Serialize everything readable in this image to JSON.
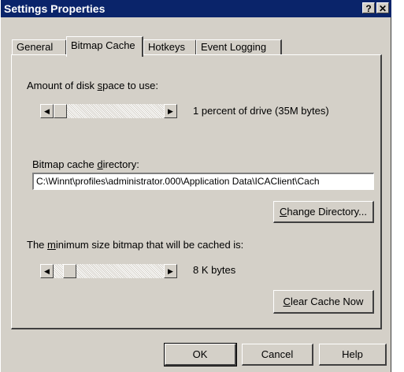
{
  "window": {
    "title": "Settings Properties",
    "help_button": "?",
    "close_button": "✕"
  },
  "tabs": [
    {
      "label": "General",
      "active": false
    },
    {
      "label": "Bitmap Cache",
      "active": true
    },
    {
      "label": "Hotkeys",
      "active": false
    },
    {
      "label": "Event Logging",
      "active": false
    }
  ],
  "disk_space": {
    "label_before": "Amount of disk ",
    "label_accel": "s",
    "label_after": "pace to use:",
    "value_text": "1 percent of drive (35M bytes)",
    "left_arrow": "◀",
    "right_arrow": "▶"
  },
  "cache_dir": {
    "label_before": "Bitmap cache ",
    "label_accel": "d",
    "label_after": "irectory:",
    "value": "C:\\Winnt\\profiles\\administrator.000\\Application Data\\ICAClient\\Cach",
    "change_button_accel": "C",
    "change_button_rest": "hange Directory..."
  },
  "min_size": {
    "label_before": "The ",
    "label_accel": "m",
    "label_after": "inimum size bitmap that will be cached is:",
    "value_text": "8  K bytes",
    "left_arrow": "◀",
    "right_arrow": "▶",
    "clear_button_accel": "C",
    "clear_button_rest": "lear Cache Now"
  },
  "footer": {
    "ok": "OK",
    "cancel": "Cancel",
    "help": "Help"
  }
}
